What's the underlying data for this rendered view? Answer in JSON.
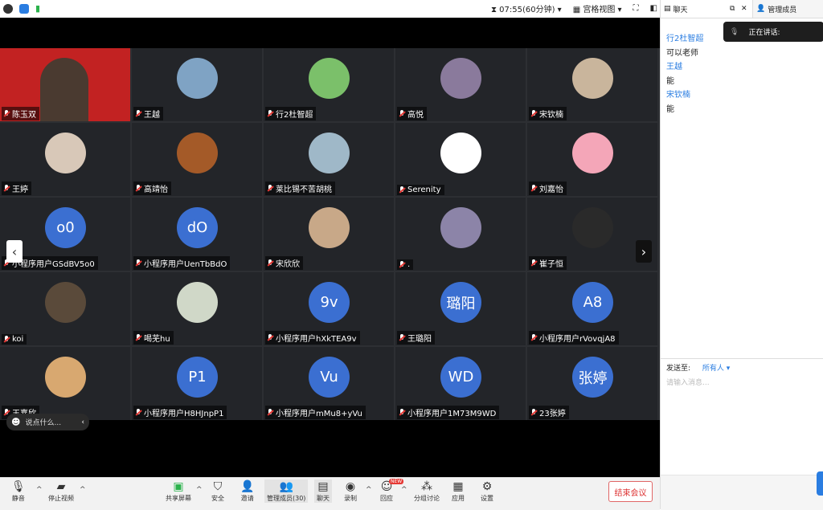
{
  "topbar": {
    "timer": "07:55(60分钟)",
    "view_label": "宫格视图"
  },
  "participants": [
    {
      "name": "陈玉双",
      "kind": "video",
      "bg": "#c22222"
    },
    {
      "name": "王越",
      "kind": "photo",
      "bg": "#7fa3c4"
    },
    {
      "name": "行2杜智超",
      "kind": "photo",
      "bg": "#7bc06a"
    },
    {
      "name": "高悦",
      "kind": "photo",
      "bg": "#8a7a9c"
    },
    {
      "name": "宋钦楠",
      "kind": "photo",
      "bg": "#c9b59c"
    },
    {
      "name": "王婷",
      "kind": "photo",
      "bg": "#d8c8b8"
    },
    {
      "name": "高靖怡",
      "kind": "photo",
      "bg": "#a45a28"
    },
    {
      "name": "莱比锡不苦胡桃",
      "kind": "photo",
      "bg": "#9fb8c8"
    },
    {
      "name": "Serenity",
      "kind": "photo",
      "bg": "#ffffff"
    },
    {
      "name": "刘嘉怡",
      "kind": "photo",
      "bg": "#f4a6b8"
    },
    {
      "name": "小程序用户GSdBV5o0",
      "kind": "letter",
      "letter": "o0"
    },
    {
      "name": "小程序用户UenTbBdO",
      "kind": "letter",
      "letter": "dO"
    },
    {
      "name": "宋欣欣",
      "kind": "photo",
      "bg": "#c8a888"
    },
    {
      "name": ".",
      "kind": "photo",
      "bg": "#8c84a8"
    },
    {
      "name": "崔子恒",
      "kind": "photo",
      "bg": "#2a2a2a"
    },
    {
      "name": "koi",
      "kind": "photo",
      "bg": "#5a4a3a"
    },
    {
      "name": "喝芜hu",
      "kind": "photo",
      "bg": "#d0d8c8"
    },
    {
      "name": "小程序用户hXkTEA9v",
      "kind": "letter",
      "letter": "9v"
    },
    {
      "name": "王璐阳",
      "kind": "letter",
      "letter": "璐阳"
    },
    {
      "name": "小程序用户rVovqjA8",
      "kind": "letter",
      "letter": "A8"
    },
    {
      "name": "王嘉欣",
      "kind": "photo",
      "bg": "#d8a870"
    },
    {
      "name": "小程序用户H8HJnpP1",
      "kind": "letter",
      "letter": "P1"
    },
    {
      "name": "小程序用户mMu8+yVu",
      "kind": "letter",
      "letter": "Vu"
    },
    {
      "name": "小程序用户1M73M9WD",
      "kind": "letter",
      "letter": "WD"
    },
    {
      "name": "23张婷",
      "kind": "letter",
      "letter": "张婷"
    }
  ],
  "overlay": {
    "say_something": "说点什么..."
  },
  "toolbar": {
    "mute": "静音",
    "stop_video": "停止视频",
    "share": "共享屏幕",
    "security": "安全",
    "invite": "邀请",
    "manage": "管理成员(30)",
    "chat": "聊天",
    "record": "录制",
    "react": "回应",
    "react_badge": "NEW",
    "breakout": "分组讨论",
    "apps": "应用",
    "settings": "设置",
    "end": "结束会议"
  },
  "sidebar": {
    "tab_chat": "聊天",
    "tab_members": "管理成员",
    "speaking": "正在讲话:",
    "messages": [
      {
        "sender": "行2杜智超",
        "text": "可以老师"
      },
      {
        "sender": "王越",
        "text": "能"
      },
      {
        "sender": "宋钦楠",
        "text": "能"
      }
    ],
    "send_to": "发送至:",
    "send_target": "所有人",
    "input_placeholder": "请输入消息..."
  }
}
